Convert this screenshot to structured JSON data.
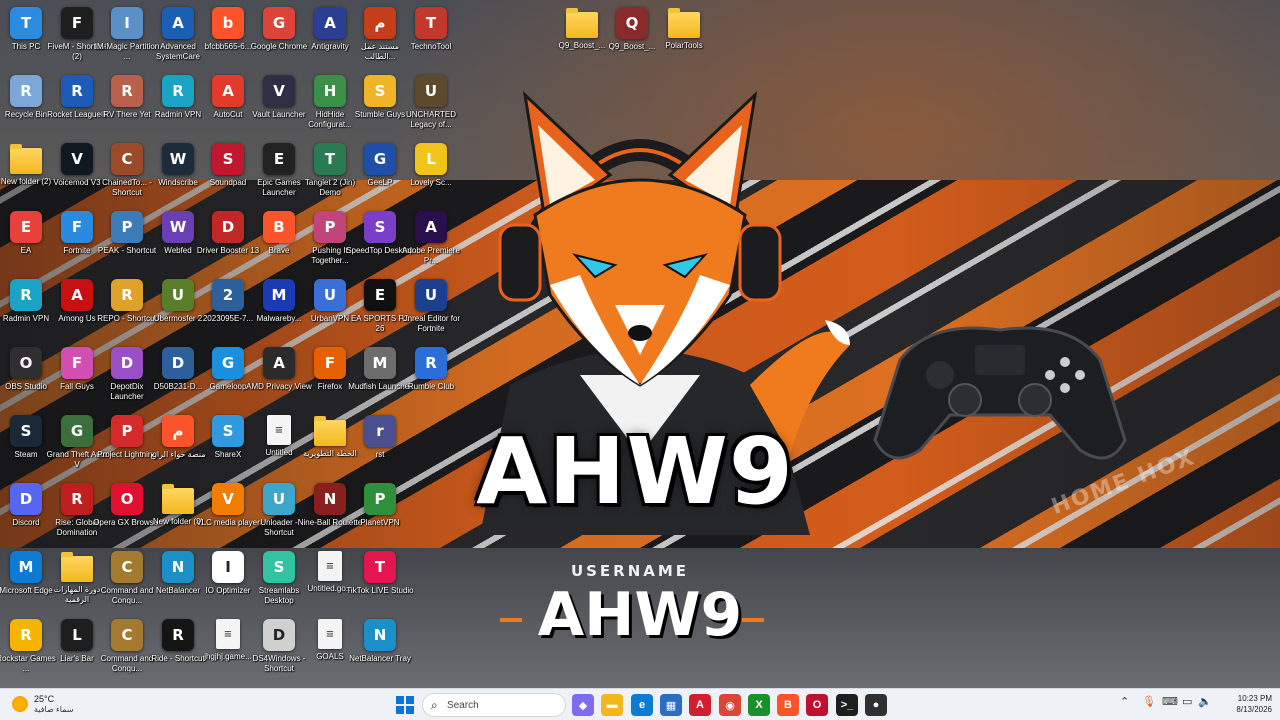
{
  "wallpaper": {
    "brand_name": "AHW9",
    "caption": "USERNAME",
    "sub_name": "AHW9",
    "tag": "HOME HOX",
    "accent": "#f07a1e"
  },
  "desktop_icons": [
    {
      "label": "This PC",
      "icon": "monitor-icon",
      "color": "#2b8be0",
      "col": 0,
      "row": 0
    },
    {
      "label": "FiveM - Shortcut (2)",
      "icon": "fivem-icon",
      "color": "#1e1e1e",
      "col": 1,
      "row": 0
    },
    {
      "label": "IM-Magic Partition ...",
      "icon": "drive-icon",
      "color": "#5a8fc7",
      "col": 2,
      "row": 0
    },
    {
      "label": "Advanced SystemCare",
      "icon": "asc-icon",
      "color": "#1a5fb4",
      "col": 3,
      "row": 0
    },
    {
      "label": "bfcbb565-6...",
      "icon": "brave-icon",
      "color": "#fb542b",
      "col": 4,
      "row": 0
    },
    {
      "label": "Google Chrome",
      "icon": "chrome-icon",
      "color": "#db4437",
      "col": 5,
      "row": 0
    },
    {
      "label": "Antigravity",
      "icon": "antigravity-icon",
      "color": "#2c3e91",
      "col": 6,
      "row": 0
    },
    {
      "label": "مستند عمل الطالب...",
      "icon": "powerpoint-icon",
      "color": "#c43e1c",
      "col": 7,
      "row": 0
    },
    {
      "label": "TechnoTool",
      "icon": "technotool-icon",
      "color": "#c0392b",
      "col": 8,
      "row": 0
    },
    {
      "label": "Recycle Bin",
      "icon": "recycle-bin-icon",
      "color": "#7aa7d8",
      "col": 0,
      "row": 1
    },
    {
      "label": "Rocket League®",
      "icon": "rocket-league-icon",
      "color": "#1e5bb8",
      "col": 1,
      "row": 1
    },
    {
      "label": "RV There Yet",
      "icon": "rv-icon",
      "color": "#b8604b",
      "col": 2,
      "row": 1
    },
    {
      "label": "Radmin VPN",
      "icon": "radmin-icon",
      "color": "#1aa3c4",
      "col": 3,
      "row": 1
    },
    {
      "label": "AutoCut",
      "icon": "autocut-icon",
      "color": "#e23b2c",
      "col": 4,
      "row": 1
    },
    {
      "label": "Vault Launcher",
      "icon": "vault-icon",
      "color": "#2e2e44",
      "col": 5,
      "row": 1
    },
    {
      "label": "HidHide Configurat...",
      "icon": "hidhide-icon",
      "color": "#3c8f47",
      "col": 6,
      "row": 1
    },
    {
      "label": "Stumble Guys",
      "icon": "stumble-icon",
      "color": "#f0b429",
      "col": 7,
      "row": 1
    },
    {
      "label": "UNCHARTED Legacy of...",
      "icon": "uncharted-icon",
      "color": "#5d4a2e",
      "col": 8,
      "row": 1
    },
    {
      "label": "New folder (2)",
      "icon": "folder-icon",
      "color": "folder",
      "col": 0,
      "row": 2
    },
    {
      "label": "Voicemod V3",
      "icon": "voicemod-icon",
      "color": "#101820",
      "col": 1,
      "row": 2
    },
    {
      "label": "ChainedTo... - Shortcut",
      "icon": "chained-icon",
      "color": "#9c4a2a",
      "col": 2,
      "row": 2
    },
    {
      "label": "Windscribe",
      "icon": "windscribe-icon",
      "color": "#1d2c3a",
      "col": 3,
      "row": 2
    },
    {
      "label": "Soundpad",
      "icon": "soundpad-icon",
      "color": "#c0192f",
      "col": 4,
      "row": 2
    },
    {
      "label": "Epic Games Launcher",
      "icon": "epic-icon",
      "color": "#222222",
      "col": 5,
      "row": 2
    },
    {
      "label": "Tanglet 2 (Jin) Demo",
      "icon": "tanglet-icon",
      "color": "#2a7a53",
      "col": 6,
      "row": 2
    },
    {
      "label": "GeeLP",
      "icon": "geelp-icon",
      "color": "#1f4fa8",
      "col": 7,
      "row": 2
    },
    {
      "label": "Lovely Sc...",
      "icon": "duck-icon",
      "color": "#f2c318",
      "col": 8,
      "row": 2
    },
    {
      "label": "EA",
      "icon": "ea-icon",
      "color": "#e8413a",
      "col": 0,
      "row": 3
    },
    {
      "label": "Fortnite",
      "icon": "fortnite-icon",
      "color": "#2a8ae0",
      "col": 1,
      "row": 3
    },
    {
      "label": "PEAK - Shortcut",
      "icon": "peak-icon",
      "color": "#3a7bb8",
      "col": 2,
      "row": 3
    },
    {
      "label": "Webfed",
      "icon": "webfed-icon",
      "color": "#6a3fb5",
      "col": 3,
      "row": 3
    },
    {
      "label": "Driver Booster 13",
      "icon": "driver-booster-icon",
      "color": "#c02727",
      "col": 4,
      "row": 3
    },
    {
      "label": "Brave",
      "icon": "brave-icon",
      "color": "#fb542b",
      "col": 5,
      "row": 3
    },
    {
      "label": "Pushing It Together...",
      "icon": "pushing-icon",
      "color": "#c1447a",
      "col": 6,
      "row": 3
    },
    {
      "label": "SpeedTop Desktop",
      "icon": "speedtop-icon",
      "color": "#7a3fc9",
      "col": 7,
      "row": 3
    },
    {
      "label": "Adobe Premiere Pr...",
      "icon": "premiere-icon",
      "color": "#2a0f4e",
      "col": 8,
      "row": 3
    },
    {
      "label": "Radmin VPN",
      "icon": "radmin-icon",
      "color": "#1aa3c4",
      "col": 0,
      "row": 4
    },
    {
      "label": "Among Us",
      "icon": "among-us-icon",
      "color": "#c51111",
      "col": 1,
      "row": 4
    },
    {
      "label": "REPO - Shortcut",
      "icon": "repo-icon",
      "color": "#e0a12a",
      "col": 2,
      "row": 4
    },
    {
      "label": "Ubermosfer 2",
      "icon": "uber-icon",
      "color": "#5a7d2a",
      "col": 3,
      "row": 4
    },
    {
      "label": "2023095E-7...",
      "icon": "image-icon",
      "color": "#2d5f9a",
      "col": 4,
      "row": 4
    },
    {
      "label": "Malwareby...",
      "icon": "malwarebytes-icon",
      "color": "#1a3bb3",
      "col": 5,
      "row": 4
    },
    {
      "label": "UrbanVPN",
      "icon": "urbanvpn-icon",
      "color": "#3a6fd8",
      "col": 6,
      "row": 4
    },
    {
      "label": "EA SPORTS FC 26",
      "icon": "fc26-icon",
      "color": "#101010",
      "col": 7,
      "row": 4
    },
    {
      "label": "Unreal Editor for Fortnite",
      "icon": "unreal-icon",
      "color": "#1d3f8f",
      "col": 8,
      "row": 4
    },
    {
      "label": "OBS Studio",
      "icon": "obs-icon",
      "color": "#302e31",
      "col": 0,
      "row": 5
    },
    {
      "label": "Fall Guys",
      "icon": "fall-guys-icon",
      "color": "#d14fb3",
      "col": 1,
      "row": 5
    },
    {
      "label": "DepotDix Launcher",
      "icon": "depot-icon",
      "color": "#9a4fc8",
      "col": 2,
      "row": 5
    },
    {
      "label": "D50B231-D...",
      "icon": "image-icon",
      "color": "#2d5f9a",
      "col": 3,
      "row": 5
    },
    {
      "label": "Gameloop",
      "icon": "gameloop-icon",
      "color": "#1a8fe0",
      "col": 4,
      "row": 5
    },
    {
      "label": "AMD Privacy View",
      "icon": "amd-icon",
      "color": "#2b2b2b",
      "col": 5,
      "row": 5
    },
    {
      "label": "Firefox",
      "icon": "firefox-icon",
      "color": "#e66000",
      "col": 6,
      "row": 5
    },
    {
      "label": "Mudfish Launcher",
      "icon": "mudfish-icon",
      "color": "#6d6d6d",
      "col": 7,
      "row": 5
    },
    {
      "label": "Rumble Club",
      "icon": "rumble-icon",
      "color": "#2a6fd8",
      "col": 8,
      "row": 5
    },
    {
      "label": "Steam",
      "icon": "steam-icon",
      "color": "#1b2838",
      "col": 0,
      "row": 6
    },
    {
      "label": "Grand Theft Auto V",
      "icon": "gta-icon",
      "color": "#3c6e3c",
      "col": 1,
      "row": 6
    },
    {
      "label": "Project Lightning",
      "icon": "lightning-icon",
      "color": "#d42a2a",
      "col": 2,
      "row": 6
    },
    {
      "label": "منصة حواء الرابع",
      "icon": "brave-icon",
      "color": "#fb542b",
      "col": 3,
      "row": 6
    },
    {
      "label": "ShareX",
      "icon": "sharex-icon",
      "color": "#2f9ae0",
      "col": 4,
      "row": 6
    },
    {
      "label": "Untitled",
      "icon": "doc-icon",
      "color": "doc",
      "col": 5,
      "row": 6
    },
    {
      "label": "الخطة التطويرية",
      "icon": "folder-icon",
      "color": "folder",
      "col": 6,
      "row": 6
    },
    {
      "label": "rst",
      "icon": "rst-icon",
      "color": "#4a4f8f",
      "col": 7,
      "row": 6
    },
    {
      "label": "Discord",
      "icon": "discord-icon",
      "color": "#5865f2",
      "col": 0,
      "row": 7
    },
    {
      "label": "Rise: Global Domination",
      "icon": "rise-icon",
      "color": "#c01f1f",
      "col": 1,
      "row": 7
    },
    {
      "label": "Opera GX Browser",
      "icon": "opera-icon",
      "color": "#e0102f",
      "col": 2,
      "row": 7
    },
    {
      "label": "New folder (3)",
      "icon": "folder-icon",
      "color": "folder",
      "col": 3,
      "row": 7
    },
    {
      "label": "VLC media player",
      "icon": "vlc-icon",
      "color": "#f07c00",
      "col": 4,
      "row": 7
    },
    {
      "label": "Unloader - Shortcut",
      "icon": "unloader-icon",
      "color": "#3da6c9",
      "col": 5,
      "row": 7
    },
    {
      "label": "Nine-Ball Roulette",
      "icon": "nine-ball-icon",
      "color": "#8a1f1f",
      "col": 6,
      "row": 7
    },
    {
      "label": "PlanetVPN",
      "icon": "planetvpn-icon",
      "color": "#2f8f3a",
      "col": 7,
      "row": 7
    },
    {
      "label": "Microsoft Edge",
      "icon": "edge-icon",
      "color": "#0c7bd4",
      "col": 0,
      "row": 8
    },
    {
      "label": "دورة المهارات الرقمية",
      "icon": "folder-icon",
      "color": "folder",
      "col": 1,
      "row": 8
    },
    {
      "label": "Command and Conqu...",
      "icon": "cnc-icon",
      "color": "#a47a2e",
      "col": 2,
      "row": 8
    },
    {
      "label": "NetBalancer",
      "icon": "netbalancer-icon",
      "color": "#1a8fc8",
      "col": 3,
      "row": 8
    },
    {
      "label": "IO Optimizer",
      "icon": "io-icon",
      "color": "#ffffff",
      "col": 4,
      "row": 8
    },
    {
      "label": "Streamlabs Desktop",
      "icon": "streamlabs-icon",
      "color": "#31c3a2",
      "col": 5,
      "row": 8
    },
    {
      "label": "Untitled.go...",
      "icon": "doc-icon",
      "color": "doc",
      "col": 6,
      "row": 8
    },
    {
      "label": "TikTok LIVE Studio",
      "icon": "tiktok-icon",
      "color": "#e3174f",
      "col": 7,
      "row": 8
    },
    {
      "label": "Rockstar Games ...",
      "icon": "rockstar-icon",
      "color": "#f4b400",
      "col": 0,
      "row": 9
    },
    {
      "label": "Liar's Bar",
      "icon": "liars-bar-icon",
      "color": "#1e1e1e",
      "col": 1,
      "row": 9
    },
    {
      "label": "Command and Conqu...",
      "icon": "cnc-icon",
      "color": "#a47a2e",
      "col": 2,
      "row": 9
    },
    {
      "label": "Ride - Shortcut",
      "icon": "unreal-icon",
      "color": "#151515",
      "col": 3,
      "row": 9
    },
    {
      "label": "jhgjhj.game...",
      "icon": "doc-icon",
      "color": "doc",
      "col": 4,
      "row": 9
    },
    {
      "label": "DS4Windows - Shortcut",
      "icon": "ds4-icon",
      "color": "#d0d0d0",
      "col": 5,
      "row": 9
    },
    {
      "label": "GOALS",
      "icon": "doc-icon",
      "color": "doc",
      "col": 6,
      "row": 9
    },
    {
      "label": "NetBalancer Tray",
      "icon": "netbalancer-icon",
      "color": "#1a8fc8",
      "col": 7,
      "row": 9
    }
  ],
  "desktop_icons_right": [
    {
      "label": "Q9_Boost_...",
      "icon": "folder-icon",
      "color": "folder"
    },
    {
      "label": "Q9_Boost_...",
      "icon": "winrar-icon",
      "color": "#8a2b2b"
    },
    {
      "label": "PolarTools",
      "icon": "zip-folder-icon",
      "color": "folder"
    }
  ],
  "taskbar": {
    "weather": {
      "temp": "25°C",
      "condition": "سماء صافية"
    },
    "search_placeholder": "Search",
    "apps": [
      {
        "name": "copilot-icon",
        "color": "#7b6cf0",
        "glyph": "◆"
      },
      {
        "name": "file-explorer-icon",
        "color": "#f3b71e",
        "glyph": "▬"
      },
      {
        "name": "edge-icon",
        "color": "#0c7bd4",
        "glyph": "e"
      },
      {
        "name": "store-icon",
        "color": "#2b6cc4",
        "glyph": "▦"
      },
      {
        "name": "amd-icon",
        "color": "#d01f2f",
        "glyph": "A"
      },
      {
        "name": "chrome-icon",
        "color": "#db4437",
        "glyph": "◉"
      },
      {
        "name": "xbox-icon",
        "color": "#1a8f2a",
        "glyph": "X"
      },
      {
        "name": "brave-icon",
        "color": "#fb542b",
        "glyph": "B"
      },
      {
        "name": "opera-icon",
        "color": "#c0102f",
        "glyph": "O"
      },
      {
        "name": "terminal-icon",
        "color": "#1e1e1e",
        "glyph": ">_"
      },
      {
        "name": "davinci-icon",
        "color": "#303030",
        "glyph": "●"
      }
    ],
    "clock": {
      "time": "10:23 PM",
      "date": "8/13/2026"
    }
  }
}
